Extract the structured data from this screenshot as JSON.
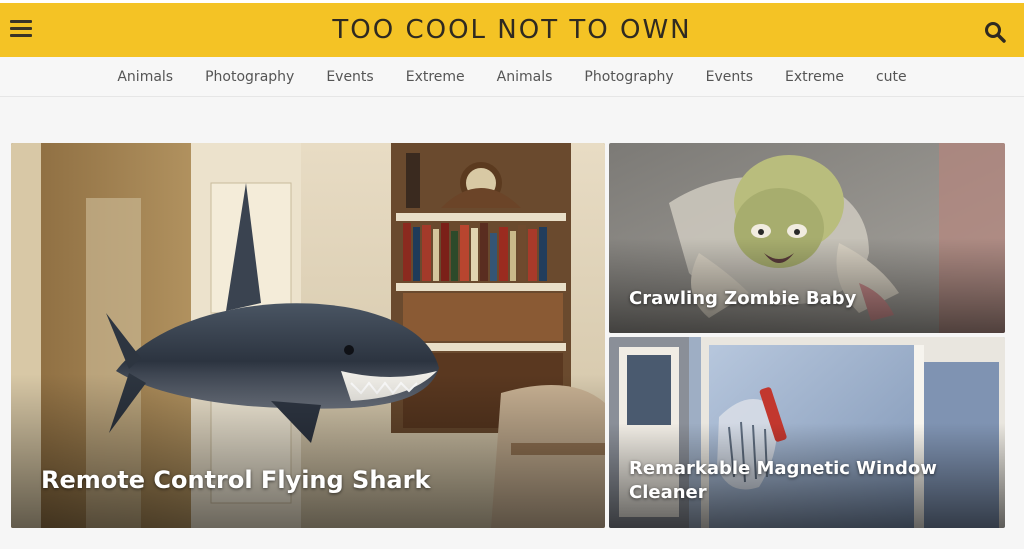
{
  "header": {
    "title": "TOO COOL NOT TO OWN",
    "menu_icon": "hamburger-menu-icon",
    "search_icon": "search-icon",
    "bg_color": "#f4c325"
  },
  "nav": {
    "items": [
      "Animals",
      "Photography",
      "Events",
      "Extreme",
      "Animals",
      "Photography",
      "Events",
      "Extreme",
      "cute"
    ]
  },
  "cards": {
    "main": {
      "title": "Remote Control Flying Shark"
    },
    "side_top": {
      "title": "Crawling Zombie Baby"
    },
    "side_bottom": {
      "title": "Remarkable Magnetic Window Cleaner"
    }
  }
}
